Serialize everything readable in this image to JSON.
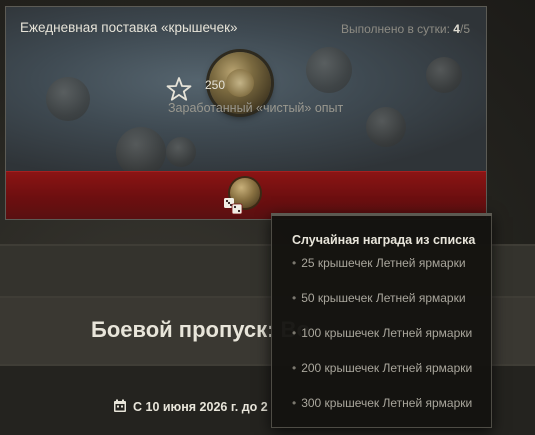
{
  "card": {
    "title": "Ежедневная поставка «крышечек»",
    "progress_label": "Выполнено в сутки: ",
    "progress_done": "4",
    "progress_total": "/5",
    "xp_value": "250",
    "xp_label": "Заработанный «чистый» опыт"
  },
  "headline": "Боевой пропуск: Во",
  "date_text": "С 10 июня 2026 г. до 2",
  "tooltip": {
    "title": "Случайная награда из списка",
    "items": [
      "25 крышечек Летней ярмарки",
      "50 крышечек Летней ярмарки",
      "100 крышечек Летней ярмарки",
      "200 крышечек Летней ярмарки",
      "300 крышечек Летней ярмарки"
    ],
    "bullet": "•"
  },
  "colors": {
    "accent_red": "#7a1213",
    "background": "#2a2924"
  },
  "icons": [
    "star-icon",
    "coin-icon",
    "dice-icon",
    "calendar-icon"
  ]
}
